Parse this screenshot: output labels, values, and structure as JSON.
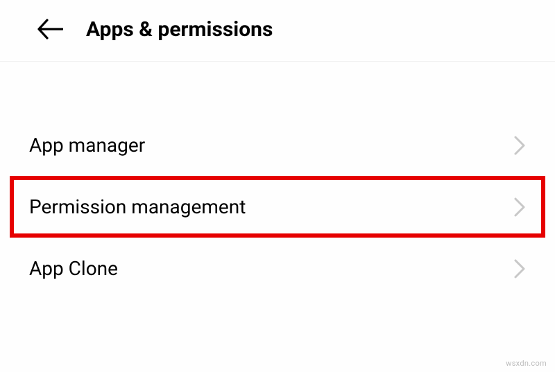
{
  "header": {
    "title": "Apps & permissions"
  },
  "items": [
    {
      "label": "App manager",
      "highlighted": false
    },
    {
      "label": "Permission management",
      "highlighted": true
    },
    {
      "label": "App Clone",
      "highlighted": false
    }
  ],
  "watermark": "wsxdn.com"
}
